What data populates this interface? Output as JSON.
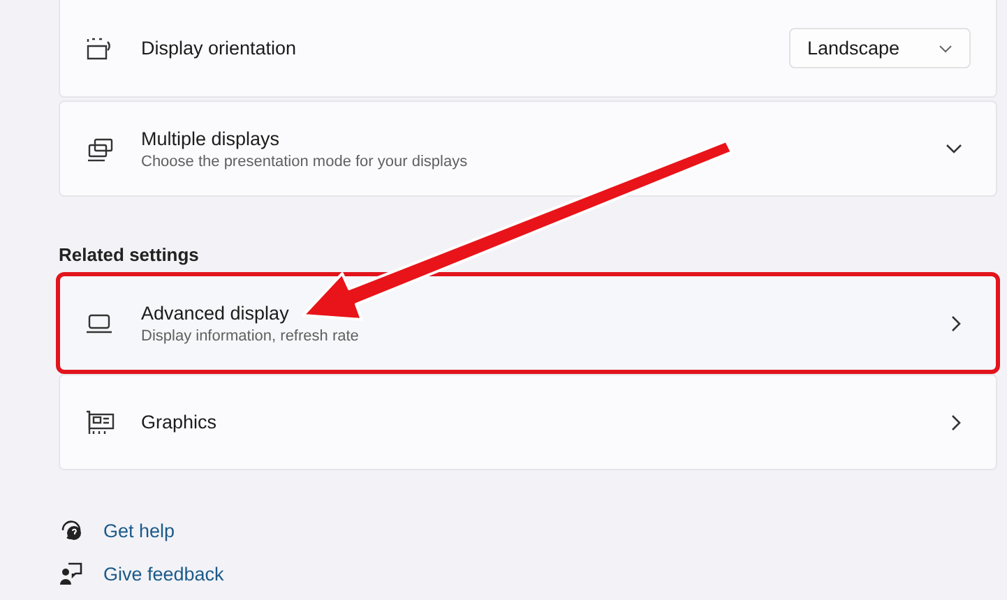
{
  "cards": [
    {
      "kind": "dropdown",
      "title": "Display orientation",
      "value": "Landscape",
      "highlighted": false
    },
    {
      "kind": "expander",
      "title": "Multiple displays",
      "subtitle": "Choose the presentation mode for your displays",
      "expanded": false,
      "highlighted": false
    }
  ],
  "related_settings": {
    "heading": "Related settings",
    "cards": [
      {
        "kind": "link",
        "title": "Advanced display",
        "subtitle": "Display information, refresh rate",
        "highlighted": true
      },
      {
        "kind": "link",
        "title": "Graphics",
        "highlighted": false
      }
    ]
  },
  "links": [
    {
      "label": "Get help"
    },
    {
      "label": "Give feedback"
    }
  ]
}
